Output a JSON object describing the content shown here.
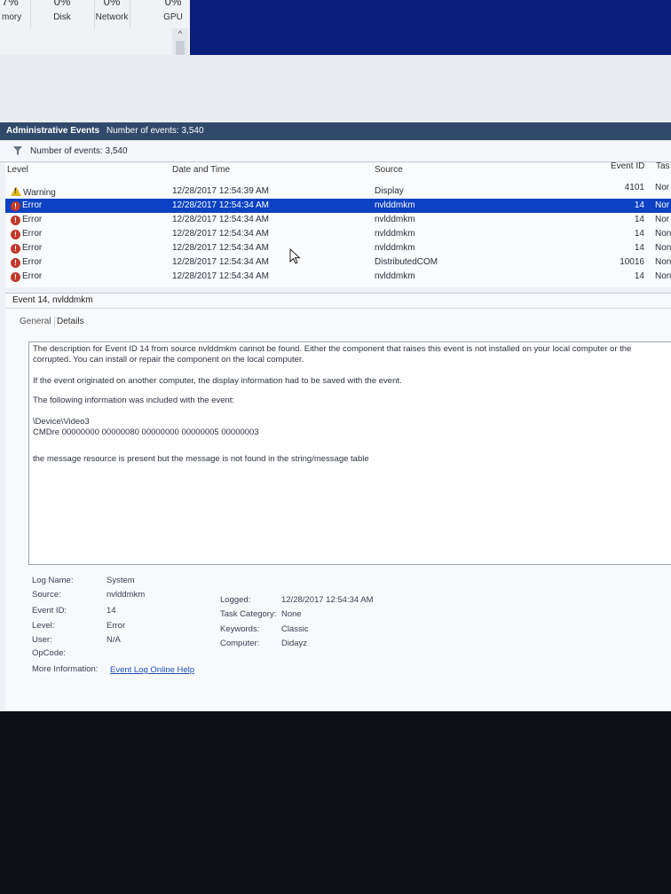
{
  "task_manager": {
    "columns": [
      {
        "pct": "7%",
        "label": "mory"
      },
      {
        "pct": "0%",
        "label": "Disk"
      },
      {
        "pct": "0%",
        "label": "Network"
      },
      {
        "pct": "0%",
        "label": "GPU"
      }
    ],
    "scroll_up": "^"
  },
  "title_bar": {
    "title": "Administrative Events",
    "count": "Number of events: 3,540"
  },
  "filter_bar": {
    "icon": "filter-icon",
    "label": "Number of events: 3,540"
  },
  "grid": {
    "headers": {
      "level": "Level",
      "date": "Date and Time",
      "source": "Source",
      "event_id": "Event ID",
      "task": "Tas"
    },
    "rows": [
      {
        "level": "Warning",
        "date": "12/28/2017 12:54:39 AM",
        "source": "Display",
        "event_id": "4101",
        "task": "Nor"
      },
      {
        "level": "Error",
        "date": "12/28/2017 12:54:34 AM",
        "source": "nvlddmkm",
        "event_id": "14",
        "task": "Nor"
      },
      {
        "level": "Error",
        "date": "12/28/2017 12:54:34 AM",
        "source": "nvlddmkm",
        "event_id": "14",
        "task": "Nor"
      },
      {
        "level": "Error",
        "date": "12/28/2017 12:54:34 AM",
        "source": "nvlddmkm",
        "event_id": "14",
        "task": "Non"
      },
      {
        "level": "Error",
        "date": "12/28/2017 12:54:34 AM",
        "source": "nvlddmkm",
        "event_id": "14",
        "task": "Non"
      },
      {
        "level": "Error",
        "date": "12/28/2017 12:54:34 AM",
        "source": "DistributedCOM",
        "event_id": "10016",
        "task": "Non"
      },
      {
        "level": "Error",
        "date": "12/28/2017 12:54:34 AM",
        "source": "nvlddmkm",
        "event_id": "14",
        "task": "Non"
      }
    ],
    "selected_index": 1
  },
  "event": {
    "title": "Event 14, nvlddmkm",
    "tabs": {
      "general": "General",
      "details": "Details"
    },
    "description": {
      "line1": "The description for Event ID 14 from source nvlddmkm cannot be found. Either the component that raises this event is not installed on your local computer or the",
      "line2": "corrupted. You can install or repair the component on the local computer.",
      "line3": "If the event originated on another computer, the display information had to be saved with the event.",
      "line4": "The following information was included with the event:",
      "line5": "\\Device\\Video3",
      "line6": "CMDre 00000000 00000080 00000000 00000005 00000003",
      "line7": "the message resource is present but the message is not found in the string/message table"
    },
    "props": {
      "log_name_label": "Log Name:",
      "log_name": "System",
      "source_label": "Source:",
      "source": "nvlddmkm",
      "event_id_label": "Event ID:",
      "event_id": "14",
      "level_label": "Level:",
      "level": "Error",
      "user_label": "User:",
      "user": "N/A",
      "opcode_label": "OpCode:",
      "more_info_label": "More Information:",
      "more_info_link": "Event Log Online Help",
      "logged_label": "Logged:",
      "logged": "12/28/2017 12:54:34 AM",
      "task_category_label": "Task Category:",
      "task_category": "None",
      "keywords_label": "Keywords:",
      "keywords": "Classic",
      "computer_label": "Computer:",
      "computer": "Didayz"
    }
  },
  "colors": {
    "selection": "#0b41c2",
    "title_bar": "#314a6c",
    "taskbar": "#0a1e7c"
  }
}
